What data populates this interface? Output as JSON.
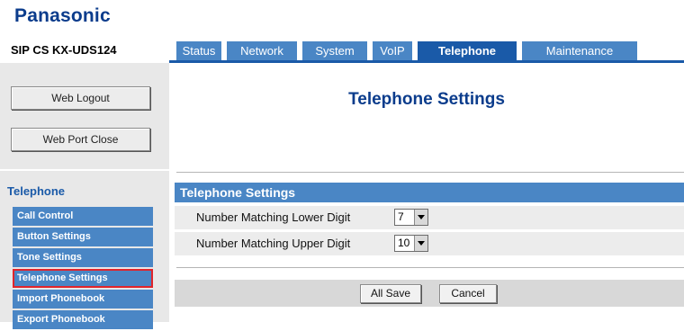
{
  "header": {
    "logo": "Panasonic",
    "model": "SIP CS KX-UDS124"
  },
  "tabs": [
    {
      "label": "Status"
    },
    {
      "label": "Network"
    },
    {
      "label": "System"
    },
    {
      "label": "VoIP"
    },
    {
      "label": "Telephone",
      "active": true
    },
    {
      "label": "Maintenance"
    }
  ],
  "sidebar": {
    "logout_label": "Web Logout",
    "port_close_label": "Web Port Close",
    "section_title": "Telephone",
    "items": [
      {
        "label": "Call Control"
      },
      {
        "label": "Button Settings"
      },
      {
        "label": "Tone Settings"
      },
      {
        "label": "Telephone Settings",
        "selected": true
      },
      {
        "label": "Import Phonebook"
      },
      {
        "label": "Export Phonebook"
      }
    ]
  },
  "main": {
    "title": "Telephone Settings",
    "section_header": "Telephone Settings",
    "rows": [
      {
        "label": "Number Matching Lower Digit",
        "value": "7"
      },
      {
        "label": "Number Matching Upper Digit",
        "value": "10"
      }
    ],
    "all_save_label": "All Save",
    "cancel_label": "Cancel"
  },
  "colors": {
    "tab_blue": "#4a86c5",
    "tab_active": "#1a5aa8",
    "title_blue": "#0b3c8c",
    "selected_outline": "#e0252b"
  }
}
